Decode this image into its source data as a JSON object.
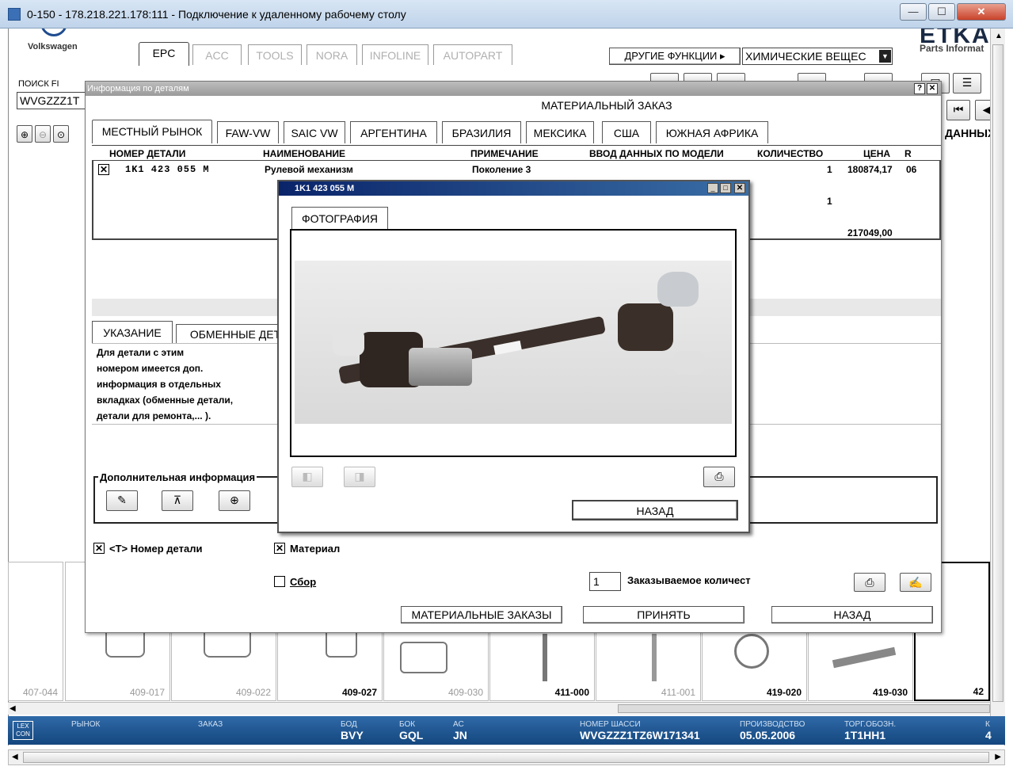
{
  "window": {
    "title": "0-150 - 178.218.221.178:111 - Подключение к удаленному рабочему столу",
    "minimize": "—",
    "maximize": "☐",
    "close": "✕"
  },
  "app": {
    "brand": "Volkswagen",
    "etka_logo": "ETKA",
    "etka_sub": "Parts Informat",
    "tabs": [
      "EPC",
      "ACC",
      "TOOLS",
      "NORA",
      "INFOLINE",
      "AUTOPART"
    ],
    "other_functions": "ДРУГИЕ ФУНКЦИИ ▸",
    "chem_select": "ХИМИЧЕСКИЕ ВЕЩЕС",
    "search_label": "ПОИСК FI",
    "search_value": "WVGZZZ1T",
    "right_label": "ДАННЫХ"
  },
  "dialog": {
    "header": "Информация по деталям",
    "help": "?",
    "close": "✕",
    "title": "МАТЕРИАЛЬНЫЙ ЗАКАЗ",
    "market_tabs": [
      "МЕСТНЫЙ РЫНОК",
      "FAW-VW",
      "SAIC VW",
      "АРГЕНТИНА",
      "БРАЗИЛИЯ",
      "МЕКСИКА",
      "США",
      "ЮЖНАЯ АФРИКА"
    ],
    "columns": [
      "НОМЕР ДЕТАЛИ",
      "НАИМЕНОВАНИЕ",
      "ПРИМЕЧАНИЕ",
      "ВВОД ДАННЫХ ПО МОДЕЛИ",
      "КОЛИЧЕСТВО",
      "ЦЕНА",
      "R"
    ],
    "row": {
      "part": "1K1 423 055 M",
      "name": "Рулевой механизм",
      "note": "Поколение 3",
      "qty": "1",
      "price": "180874,17",
      "r": "06"
    },
    "qty2": "1",
    "total": "217049,00",
    "info_tabs": [
      "УКАЗАНИЕ",
      "ОБМЕННЫЕ ДЕТ"
    ],
    "info_text": [
      "Для детали с этим",
      "номером имеется доп.",
      "информация в отдельных",
      "вкладках (обменные детали,",
      "детали для ремонта,... )."
    ],
    "extra_info": "Дополнительная информация",
    "check_part": "<T> Номер детали",
    "check_material": "Материал",
    "check_assembly": "Сбор",
    "order_qty_value": "1",
    "order_qty_label": "Заказываемое количест",
    "btn_material_orders": "МАТЕРИАЛЬНЫЕ ЗАКАЗЫ",
    "btn_accept": "ПРИНЯТЬ",
    "btn_back": "НАЗАД"
  },
  "popup": {
    "title": "1K1 423 055 M",
    "tab": "ФОТОГРАФИЯ",
    "btn_back": "НАЗАД"
  },
  "thumbnails": [
    {
      "label": "407-044",
      "active": false
    },
    {
      "label": "409-017",
      "active": false
    },
    {
      "label": "409-022",
      "active": false
    },
    {
      "label": "409-027",
      "active": true
    },
    {
      "label": "409-030",
      "active": false
    },
    {
      "label": "411-000",
      "active": true
    },
    {
      "label": "411-001",
      "active": false
    },
    {
      "label": "419-020",
      "active": true
    },
    {
      "label": "419-030",
      "active": true
    },
    {
      "label": "42",
      "active": true
    }
  ],
  "status": {
    "logo": "LEX CON",
    "market_k": "РЫНОК",
    "order_k": "ЗАКАЗ",
    "bod_k": "БОД",
    "bod_v": "BVY",
    "bok_k": "БОК",
    "bok_v": "GQL",
    "ac_k": "АС",
    "ac_v": "JN",
    "vin_k": "НОМЕР ШАССИ",
    "vin_v": "WVGZZZ1TZ6W171341",
    "prod_k": "ПРОИЗВОДСТВО",
    "prod_v": "05.05.2006",
    "trade_k": "ТОРГ.ОБОЗН.",
    "trade_v": "1T1HH1",
    "edge_k": "К",
    "edge_v": "4"
  }
}
